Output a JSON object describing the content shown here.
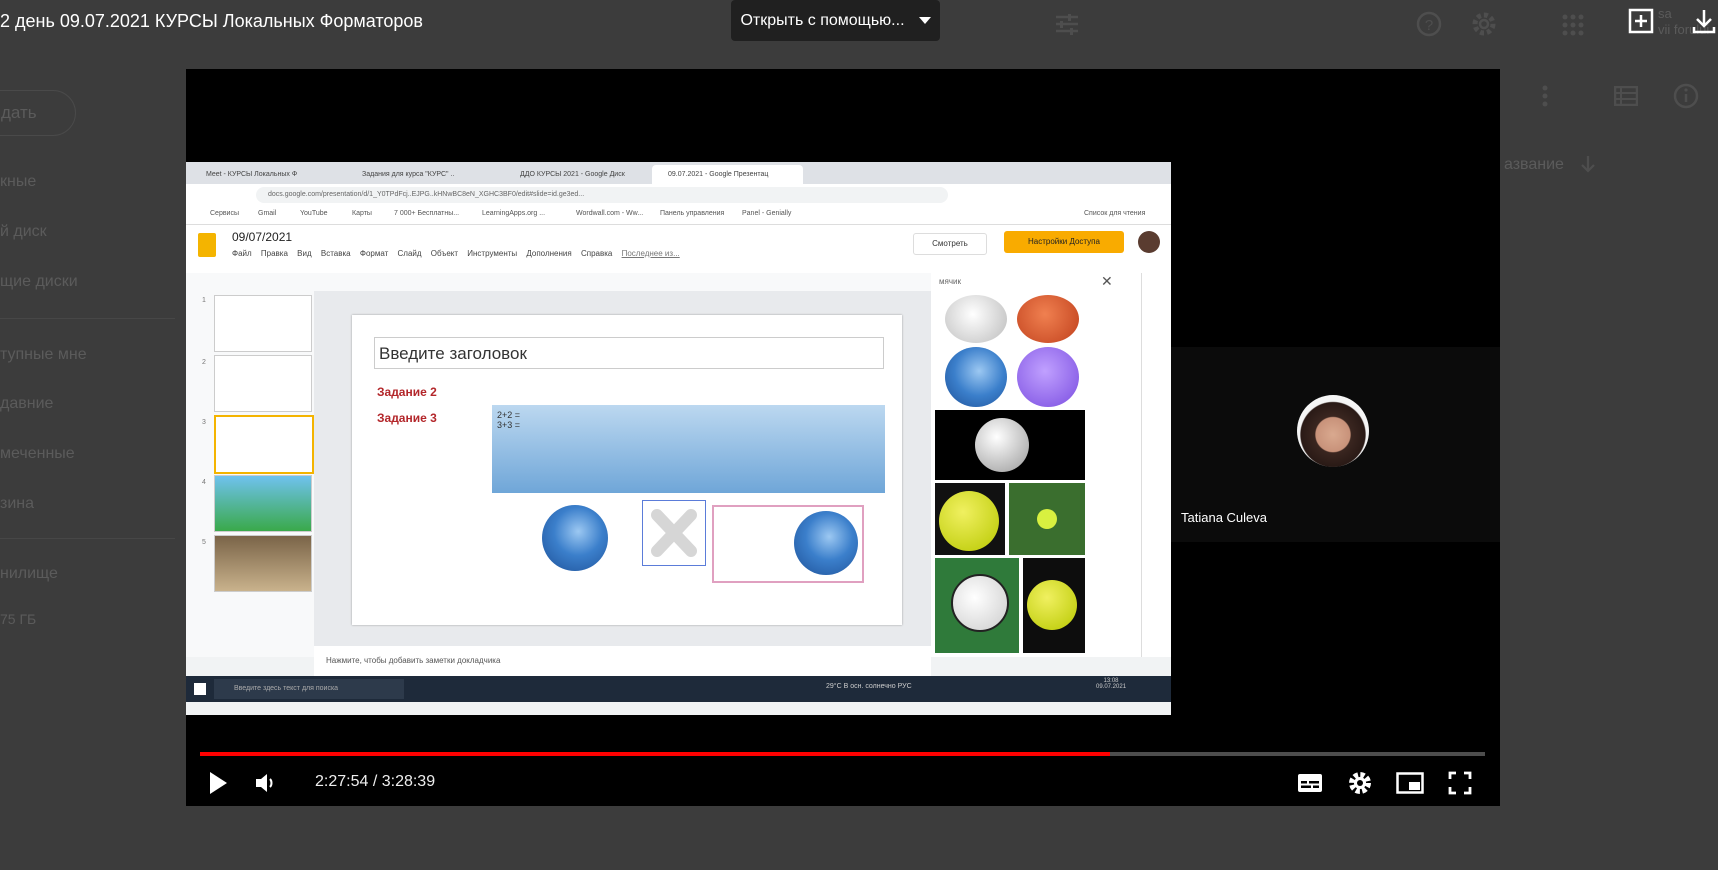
{
  "header": {
    "doc_title": "2 день 09.07.2021 КУРСЫ Локальных Форматоров",
    "open_with_label": "Открыть с помощью...",
    "right_partial_1": "sa",
    "right_partial_2": "vii forului"
  },
  "sidebar": {
    "create_label": "дать",
    "items": [
      {
        "label": "кные"
      },
      {
        "label": "й диск"
      },
      {
        "label": "щие диски"
      },
      {
        "label": "тупные мне"
      },
      {
        "label": "давние"
      },
      {
        "label": "меченные"
      },
      {
        "label": "зина"
      }
    ],
    "storage_label": "нилище",
    "storage_value": "75 ГБ"
  },
  "drive_list": {
    "sort_label": "азвание"
  },
  "shared_screen": {
    "browser_tabs": [
      "Meet - КУРСЫ Локальных Ф",
      "Задания для курса \"КУРС\" ..",
      "ДДО КУРСЫ 2021 - Google Диск",
      "09.07.2021 - Google Презентац"
    ],
    "url": "docs.google.com/presentation/d/1_Y0TPdFcj..EJPG..kHNwBC8eN_XGHC3BF0/edit#slide=id.ge3ed...",
    "bookmarks": [
      "Сервисы",
      "Gmail",
      "YouTube",
      "Карты",
      "7 000+ Бесплатны...",
      "LearningApps.org ...",
      "Wordwall.com - Ww...",
      "Панель управления",
      "Panel - Genially",
      "Список для чтения"
    ],
    "slides_title": "09/07/2021",
    "slides_menu": [
      "Файл",
      "Правка",
      "Вид",
      "Вставка",
      "Формат",
      "Слайд",
      "Объект",
      "Инструменты",
      "Дополнения",
      "Справка",
      "Последнее из..."
    ],
    "view_button": "Смотреть",
    "access_button": "Настройки Доступа",
    "slide": {
      "title_placeholder": "Введите заголовок",
      "task2": "Задание 2",
      "task3": "Задание 3",
      "equations": "2+2 =\n3+3 ="
    },
    "notes_placeholder": "Нажмите, чтобы добавить заметки докладчика",
    "image_search_query": "мячик",
    "taskbar_search": "Введите здесь текст для поиска",
    "tray_text": "29°C В осн. солнечно   РУС",
    "tray_clock": "13:08\n09.07.2021"
  },
  "participant": {
    "name": "Tatiana Culeva"
  },
  "player": {
    "current_time": "2:27:54",
    "duration": "3:28:39",
    "time_display": "2:27:54 / 3:28:39",
    "progress_fraction": 0.708
  },
  "colors": {
    "progress": "#ff0000",
    "access_button": "#f9ab00",
    "task_text": "#b3262a"
  }
}
